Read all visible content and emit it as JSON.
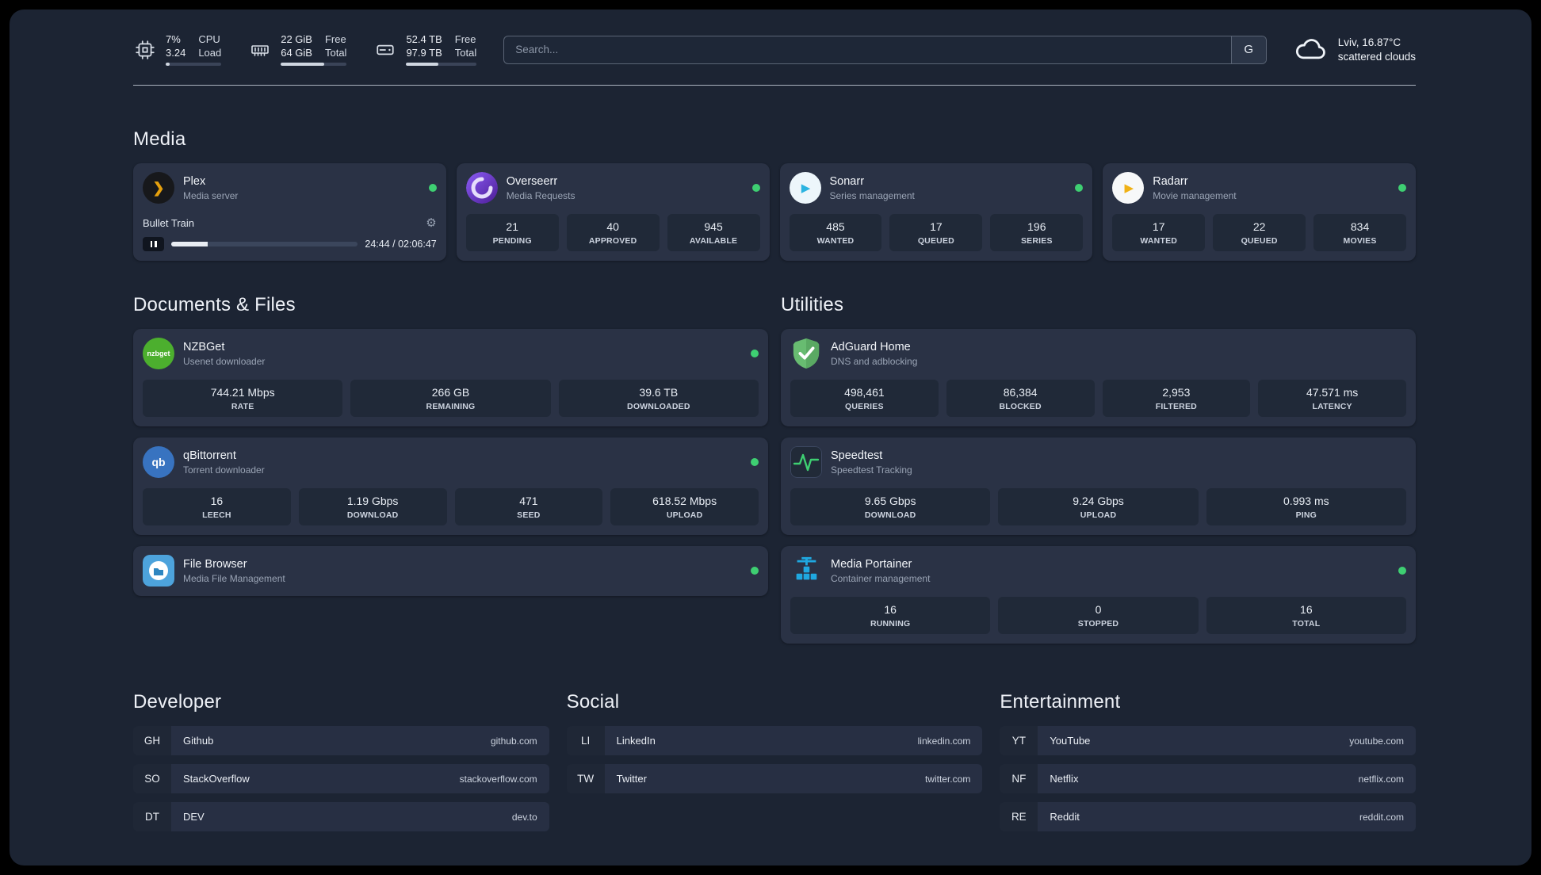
{
  "colors": {
    "status_online": "#3ecf72",
    "accent_plex": "#e5a00d"
  },
  "topbar": {
    "cpu": {
      "value_top": "7%",
      "value_bottom": "3.24",
      "label_top": "CPU",
      "label_bottom": "Load",
      "progress_percent": 7
    },
    "ram": {
      "value_top": "22 GiB",
      "value_bottom": "64 GiB",
      "label_top": "Free",
      "label_bottom": "Total",
      "progress_percent": 66
    },
    "disk": {
      "value_top": "52.4 TB",
      "value_bottom": "97.9 TB",
      "label_top": "Free",
      "label_bottom": "Total",
      "progress_percent": 46
    },
    "search": {
      "placeholder": "Search...",
      "engine_button": "G"
    },
    "weather": {
      "location": "Lviv, 16.87°C",
      "condition": "scattered clouds"
    }
  },
  "media": {
    "title": "Media",
    "plex": {
      "name": "Plex",
      "subtitle": "Media server",
      "now_playing": "Bullet Train",
      "time": "24:44 / 02:06:47",
      "progress_percent": 19.5
    },
    "overseerr": {
      "name": "Overseerr",
      "subtitle": "Media Requests",
      "stats": [
        {
          "value": "21",
          "label": "PENDING"
        },
        {
          "value": "40",
          "label": "APPROVED"
        },
        {
          "value": "945",
          "label": "AVAILABLE"
        }
      ]
    },
    "sonarr": {
      "name": "Sonarr",
      "subtitle": "Series management",
      "stats": [
        {
          "value": "485",
          "label": "WANTED"
        },
        {
          "value": "17",
          "label": "QUEUED"
        },
        {
          "value": "196",
          "label": "SERIES"
        }
      ]
    },
    "radarr": {
      "name": "Radarr",
      "subtitle": "Movie management",
      "stats": [
        {
          "value": "17",
          "label": "WANTED"
        },
        {
          "value": "22",
          "label": "QUEUED"
        },
        {
          "value": "834",
          "label": "MOVIES"
        }
      ]
    }
  },
  "documents": {
    "title": "Documents & Files",
    "nzbget": {
      "name": "NZBGet",
      "subtitle": "Usenet downloader",
      "icon_text": "nzbget",
      "stats": [
        {
          "value": "744.21 Mbps",
          "label": "RATE"
        },
        {
          "value": "266 GB",
          "label": "REMAINING"
        },
        {
          "value": "39.6 TB",
          "label": "DOWNLOADED"
        }
      ]
    },
    "qbittorrent": {
      "name": "qBittorrent",
      "subtitle": "Torrent downloader",
      "icon_text": "qb",
      "stats": [
        {
          "value": "16",
          "label": "LEECH"
        },
        {
          "value": "1.19 Gbps",
          "label": "DOWNLOAD"
        },
        {
          "value": "471",
          "label": "SEED"
        },
        {
          "value": "618.52 Mbps",
          "label": "UPLOAD"
        }
      ]
    },
    "filebrowser": {
      "name": "File Browser",
      "subtitle": "Media File Management"
    }
  },
  "utilities": {
    "title": "Utilities",
    "adguard": {
      "name": "AdGuard Home",
      "subtitle": "DNS and adblocking",
      "stats": [
        {
          "value": "498,461",
          "label": "QUERIES"
        },
        {
          "value": "86,384",
          "label": "BLOCKED"
        },
        {
          "value": "2,953",
          "label": "FILTERED"
        },
        {
          "value": "47.571 ms",
          "label": "LATENCY"
        }
      ]
    },
    "speedtest": {
      "name": "Speedtest",
      "subtitle": "Speedtest Tracking",
      "stats": [
        {
          "value": "9.65 Gbps",
          "label": "DOWNLOAD"
        },
        {
          "value": "9.24 Gbps",
          "label": "UPLOAD"
        },
        {
          "value": "0.993 ms",
          "label": "PING"
        }
      ]
    },
    "portainer": {
      "name": "Media Portainer",
      "subtitle": "Container management",
      "stats": [
        {
          "value": "16",
          "label": "RUNNING"
        },
        {
          "value": "0",
          "label": "STOPPED"
        },
        {
          "value": "16",
          "label": "TOTAL"
        }
      ]
    }
  },
  "bookmarks": {
    "developer": {
      "title": "Developer",
      "items": [
        {
          "abbr": "GH",
          "name": "Github",
          "url": "github.com"
        },
        {
          "abbr": "SO",
          "name": "StackOverflow",
          "url": "stackoverflow.com"
        },
        {
          "abbr": "DT",
          "name": "DEV",
          "url": "dev.to"
        }
      ]
    },
    "social": {
      "title": "Social",
      "items": [
        {
          "abbr": "LI",
          "name": "LinkedIn",
          "url": "linkedin.com"
        },
        {
          "abbr": "TW",
          "name": "Twitter",
          "url": "twitter.com"
        }
      ]
    },
    "entertainment": {
      "title": "Entertainment",
      "items": [
        {
          "abbr": "YT",
          "name": "YouTube",
          "url": "youtube.com"
        },
        {
          "abbr": "NF",
          "name": "Netflix",
          "url": "netflix.com"
        },
        {
          "abbr": "RE",
          "name": "Reddit",
          "url": "reddit.com"
        }
      ]
    }
  },
  "icons": {
    "plex_glyph": "❯",
    "sonarr_glyph": "▶",
    "radarr_glyph": "▶",
    "gear_glyph": "⚙"
  }
}
